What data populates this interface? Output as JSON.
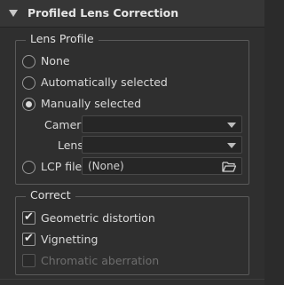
{
  "header": {
    "title": "Profiled Lens Correction",
    "expander_icon": "triangle-down-icon"
  },
  "lens_profile": {
    "title": "Lens Profile",
    "options": [
      {
        "label": "None",
        "selected": false
      },
      {
        "label": "Automatically selected",
        "selected": false
      },
      {
        "label": "Manually selected",
        "selected": true
      }
    ],
    "camera_label": "Camera",
    "camera_value": "",
    "lens_label": "Lens",
    "lens_value": "",
    "lcp_label": "LCP file",
    "lcp_selected": false,
    "lcp_value": "(None)",
    "browse_icon": "folder-open-icon"
  },
  "correct": {
    "title": "Correct",
    "items": [
      {
        "label": "Geometric distortion",
        "checked": true,
        "enabled": true
      },
      {
        "label": "Vignetting",
        "checked": true,
        "enabled": true
      },
      {
        "label": "Chromatic aberration",
        "checked": false,
        "enabled": false
      }
    ]
  }
}
